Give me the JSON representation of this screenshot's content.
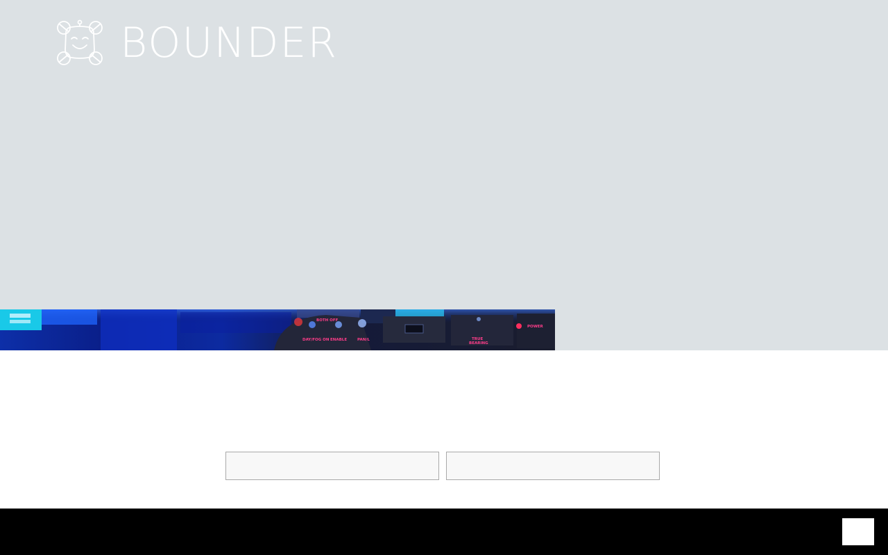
{
  "brand": {
    "name": "BOUNDER",
    "logo_icon": "bounder-face-logo-icon"
  },
  "hero": {
    "photo": "cockpit-control-panel-photo",
    "photo_labels": [
      "BOTH OFF",
      "DAY/FOG ON",
      "ENABLE",
      "PAN/L",
      "TRUE BEARING",
      "POWER"
    ]
  },
  "colors": {
    "hero_bg": "#dce1e4",
    "footer_bg": "#000000",
    "field_bg": "#f8f8f8",
    "field_border": "#a9a9a9"
  },
  "fields": [
    {
      "value": "",
      "placeholder": ""
    },
    {
      "value": "",
      "placeholder": ""
    }
  ],
  "footer": {
    "button_label": ""
  }
}
